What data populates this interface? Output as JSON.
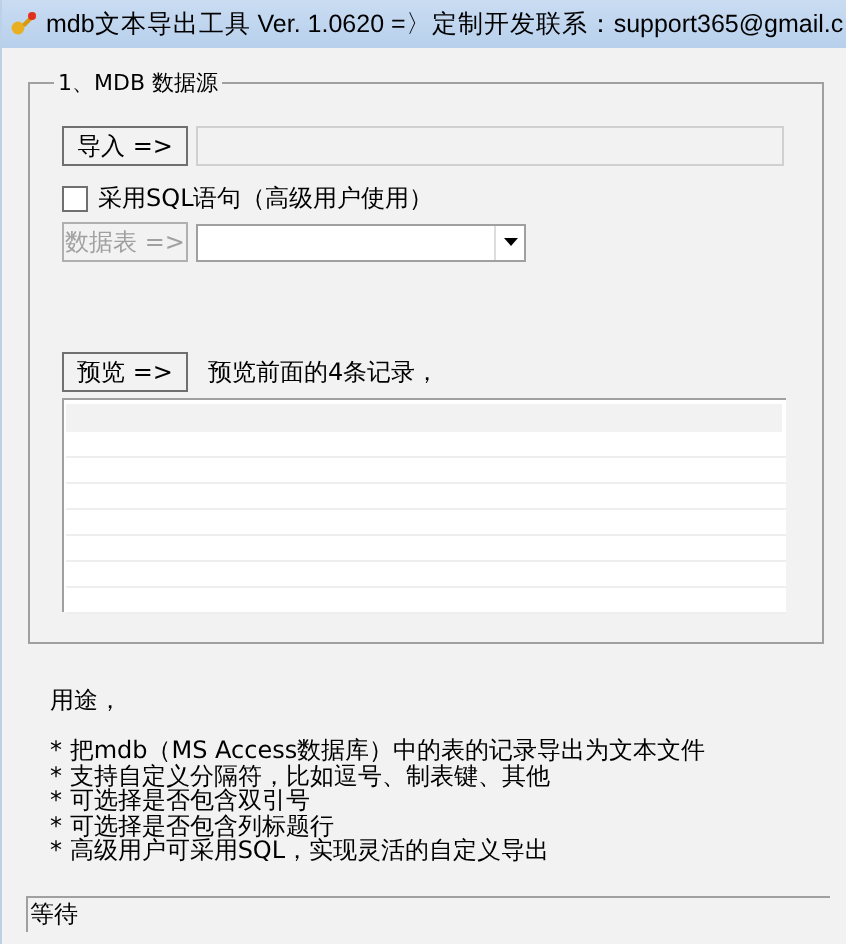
{
  "window": {
    "title": "mdb文本导出工具 Ver. 1.0620  =〉定制开发联系：support365@gmail.c"
  },
  "source_group": {
    "legend": "1、MDB 数据源",
    "import_button": {
      "label": "导入 =>",
      "disabled": false
    },
    "sql_checkbox": {
      "label": "采用SQL语句（高级用户使用）",
      "checked": false
    },
    "table_button": {
      "label": "数据表 =>",
      "disabled": true
    },
    "preview_button": {
      "label": "预览 =>",
      "disabled": false
    },
    "preview_label": "预览前面的4条记录，"
  },
  "usage": {
    "title": "用途，",
    "lines": [
      "* 把mdb（MS Access数据库）中的表的记录导出为文本文件",
      "* 支持自定义分隔符，比如逗号、制表键、其他",
      "* 可选择是否包含双引号",
      "* 可选择是否包含列标题行",
      "* 高级用户可采用SQL，实现灵活的自定义导出"
    ]
  },
  "status_bar": {
    "text": "等待"
  }
}
